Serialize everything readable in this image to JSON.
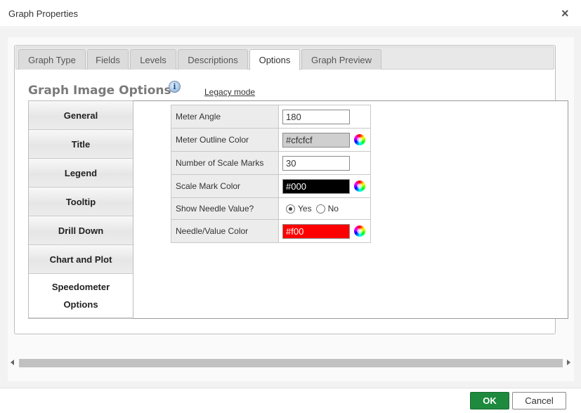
{
  "dialog": {
    "title": "Graph Properties",
    "close_glyph": "×"
  },
  "tabs": [
    {
      "label": "Graph Type"
    },
    {
      "label": "Fields"
    },
    {
      "label": "Levels"
    },
    {
      "label": "Descriptions"
    },
    {
      "label": "Options",
      "active": true
    },
    {
      "label": "Graph Preview"
    }
  ],
  "section": {
    "title": "Graph Image Options",
    "info_glyph": "i",
    "legacy_link": "Legacy mode"
  },
  "vtabs": [
    {
      "label": "General"
    },
    {
      "label": "Title"
    },
    {
      "label": "Legend"
    },
    {
      "label": "Tooltip"
    },
    {
      "label": "Drill Down"
    },
    {
      "label": "Chart and Plot"
    },
    {
      "label_line1": "Speedometer",
      "label_line2": "Options",
      "active": true
    }
  ],
  "properties": {
    "meter_angle": {
      "label": "Meter Angle",
      "value": "180"
    },
    "meter_outline_color": {
      "label": "Meter Outline Color",
      "value": "#cfcfcf",
      "bg": "#cfcfcf",
      "fg": "#333333"
    },
    "scale_marks": {
      "label": "Number of Scale Marks",
      "value": "30"
    },
    "scale_mark_color": {
      "label": "Scale Mark Color",
      "value": "#000",
      "bg": "#000000",
      "fg": "#ffffff"
    },
    "show_needle_value": {
      "label": "Show Needle Value?",
      "yes_label": "Yes",
      "no_label": "No",
      "selected": "Yes"
    },
    "needle_value_color": {
      "label": "Needle/Value Color",
      "value": "#f00",
      "bg": "#ff0000",
      "fg": "#ffffff"
    }
  },
  "footer": {
    "ok_label": "OK",
    "cancel_label": "Cancel",
    "ok_color": "#1e8a3e"
  }
}
